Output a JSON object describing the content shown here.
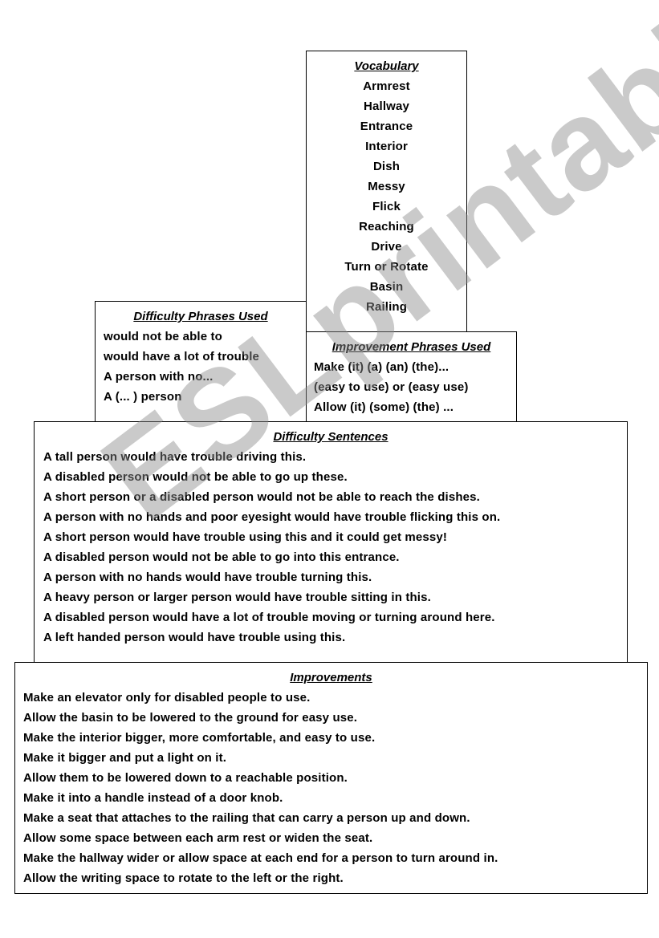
{
  "vocabulary": {
    "title": "Vocabulary",
    "items": [
      "Armrest",
      "Hallway",
      "Entrance",
      "Interior",
      "Dish",
      "Messy",
      "Flick",
      "Reaching",
      "Drive",
      "Turn or Rotate",
      "Basin",
      "Railing"
    ]
  },
  "difficulty_phrases": {
    "title": "Difficulty Phrases Used",
    "items": [
      "would not be able to",
      "would have a lot of trouble",
      "A person with no...",
      "A (... ) person"
    ]
  },
  "improvement_phrases": {
    "title": "Improvement Phrases Used",
    "items": [
      "Make (it) (a) (an) (the)...",
      "(easy to use) or (easy use)",
      "Allow (it) (some) (the) ..."
    ]
  },
  "difficulty_sentences": {
    "title": "Difficulty Sentences",
    "items": [
      "A tall person would have trouble driving this.",
      "A disabled person would not be able to go up these.",
      "A short person or a disabled person would not be able to reach the dishes.",
      "A person with no hands and poor eyesight would have trouble flicking this on.",
      "A short person would have trouble using this and it could get messy!",
      "A disabled person would not be able to go into this entrance.",
      "A person with no hands would have trouble turning this.",
      "A heavy person or larger person would have trouble sitting in this.",
      "A disabled person would have a lot of trouble moving or turning around here.",
      "A left handed person would have trouble using this."
    ]
  },
  "improvements": {
    "title": "Improvements",
    "items": [
      "Make an elevator only for disabled people to use.",
      "Allow the basin to be lowered to the ground for easy use.",
      "Make the interior bigger, more comfortable, and easy to use.",
      "Make it bigger and put a light on it.",
      "Allow them to be lowered down to a reachable position.",
      "Make it into a handle instead of a door knob.",
      "Make a seat that attaches to the railing that can carry a person up and down.",
      "Allow some space between each arm rest or widen the seat.",
      "Make the hallway wider or allow space at each end for a person to turn around in.",
      "Allow the writing space to rotate to the left or the right."
    ]
  },
  "watermark": {
    "text": "ESLprintables.com",
    "color": "#8c8c8c"
  }
}
